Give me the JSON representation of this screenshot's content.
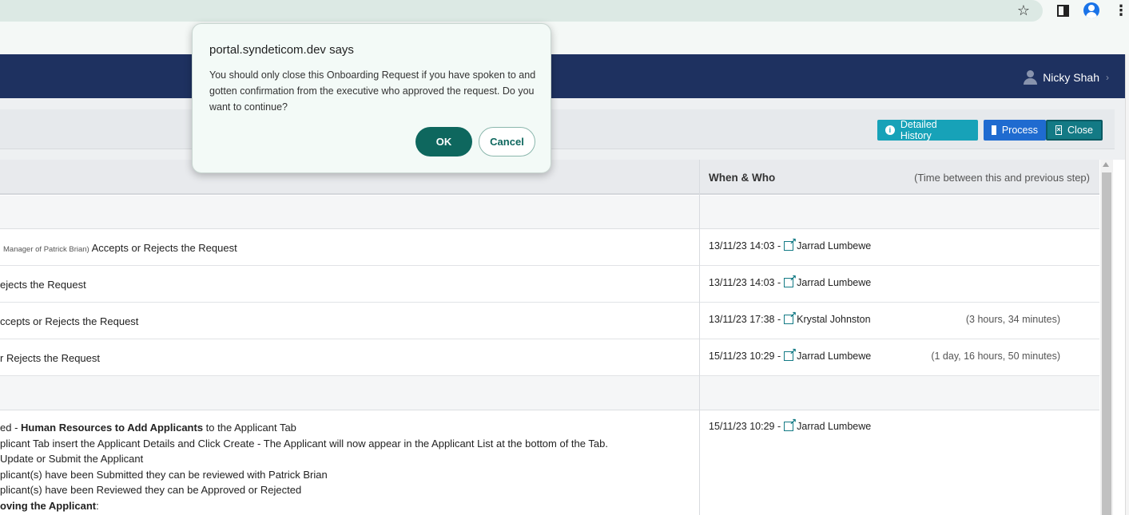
{
  "browser": {
    "icons": [
      "star-icon",
      "side-panel-icon",
      "profile-icon",
      "menu-kebab-icon"
    ]
  },
  "header": {
    "user_name": "Nicky Shah"
  },
  "toolbar": {
    "detailed_history_label": "Detailed History",
    "process_label": "Process",
    "close_label": "Close"
  },
  "table": {
    "col_when": "When & Who",
    "col_time": "(Time between this and previous step)",
    "rows": [
      {
        "prefix_small": "Manager of Patrick Brian)",
        "text": "Accepts or Rejects the Request",
        "when": "13/11/23 14:03 -",
        "who": "Jarrad Lumbewe",
        "duration": ""
      },
      {
        "prefix_small": "",
        "text": "ejects the Request",
        "when": "13/11/23 14:03 -",
        "who": "Jarrad Lumbewe",
        "duration": ""
      },
      {
        "prefix_small": "",
        "text": "ccepts or Rejects the Request",
        "when": "13/11/23 17:38 -",
        "who": "Krystal Johnston",
        "duration": "(3 hours, 34 minutes)"
      },
      {
        "prefix_small": "",
        "text": "r Rejects the Request",
        "when": "15/11/23 10:29 -",
        "who": "Jarrad Lumbewe",
        "duration": "(1 day, 16 hours, 50 minutes)"
      }
    ],
    "step": {
      "line1_pre": "ed -",
      "line1_bold": "Human Resources to Add Applicants",
      "line1_post": "to the Applicant Tab",
      "line2": "plicant Tab insert the Applicant Details and Click Create - The Applicant will now appear in the Applicant List at the bottom of the Tab.",
      "line3": "Update or Submit the Applicant",
      "line4": "plicant(s) have been Submitted they can be reviewed with Patrick Brian",
      "line5": "plicant(s) have been Reviewed they can be Approved or Rejected",
      "line6_bold": "oving the Applicant",
      "line6_post": ":",
      "when": "15/11/23 10:29 -",
      "who": "Jarrad Lumbewe"
    }
  },
  "dialog": {
    "title": "portal.syndeticom.dev says",
    "message": "You should only close this Onboarding Request if you have spoken to and gotten confirmation from the executive who approved the request. Do you want to continue?",
    "ok_label": "OK",
    "cancel_label": "Cancel"
  }
}
